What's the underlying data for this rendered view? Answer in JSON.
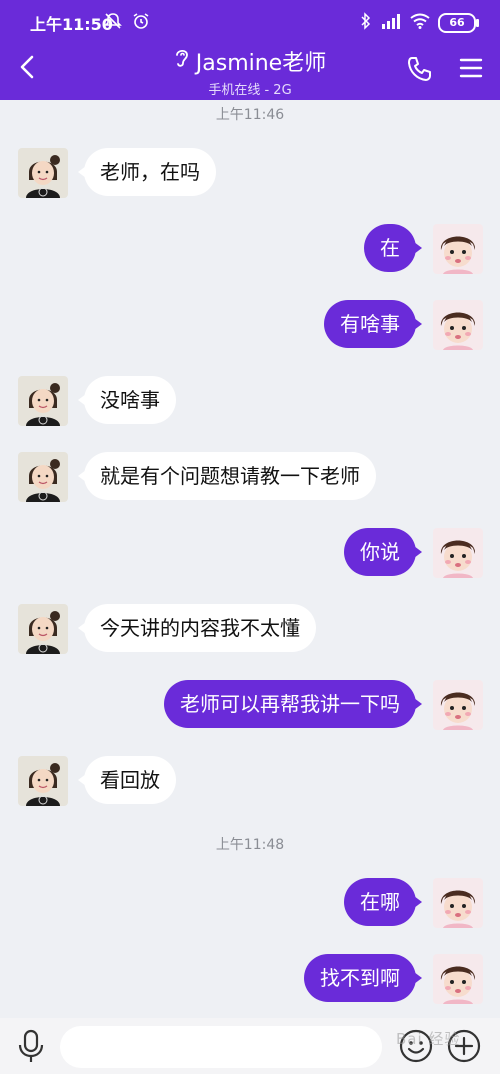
{
  "status_bar": {
    "time": "上午11:50",
    "battery": "66"
  },
  "header": {
    "title": "Jasmine老师",
    "subtitle": "手机在线 - 2G"
  },
  "chat": {
    "timestamps": [
      "上午11:46",
      "上午11:48"
    ],
    "messages": [
      {
        "side": "left",
        "text": "老师，在吗"
      },
      {
        "side": "right",
        "text": "在"
      },
      {
        "side": "right",
        "text": "有啥事"
      },
      {
        "side": "left",
        "text": "没啥事"
      },
      {
        "side": "left",
        "text": "就是有个问题想请教一下老师"
      },
      {
        "side": "right",
        "text": "你说"
      },
      {
        "side": "left",
        "text": "今天讲的内容我不太懂"
      },
      {
        "side": "right",
        "text": "老师可以再帮我讲一下吗"
      },
      {
        "side": "left",
        "text": "看回放"
      },
      {
        "side": "right",
        "text": "在哪"
      },
      {
        "side": "right",
        "text": "找不到啊"
      }
    ]
  },
  "input": {
    "placeholder": ""
  },
  "watermark": "Bai 经验",
  "colors": {
    "accent": "#6a2bd9",
    "background": "#eef0f4",
    "bubble_incoming": "#ffffff"
  },
  "icons": {
    "back": "chevron-left-icon",
    "voice_mode": "ear-icon",
    "call": "phone-icon",
    "menu": "hamburger-menu-icon",
    "mic": "microphone-icon",
    "emoji": "smiley-icon",
    "more": "plus-circle-icon"
  }
}
